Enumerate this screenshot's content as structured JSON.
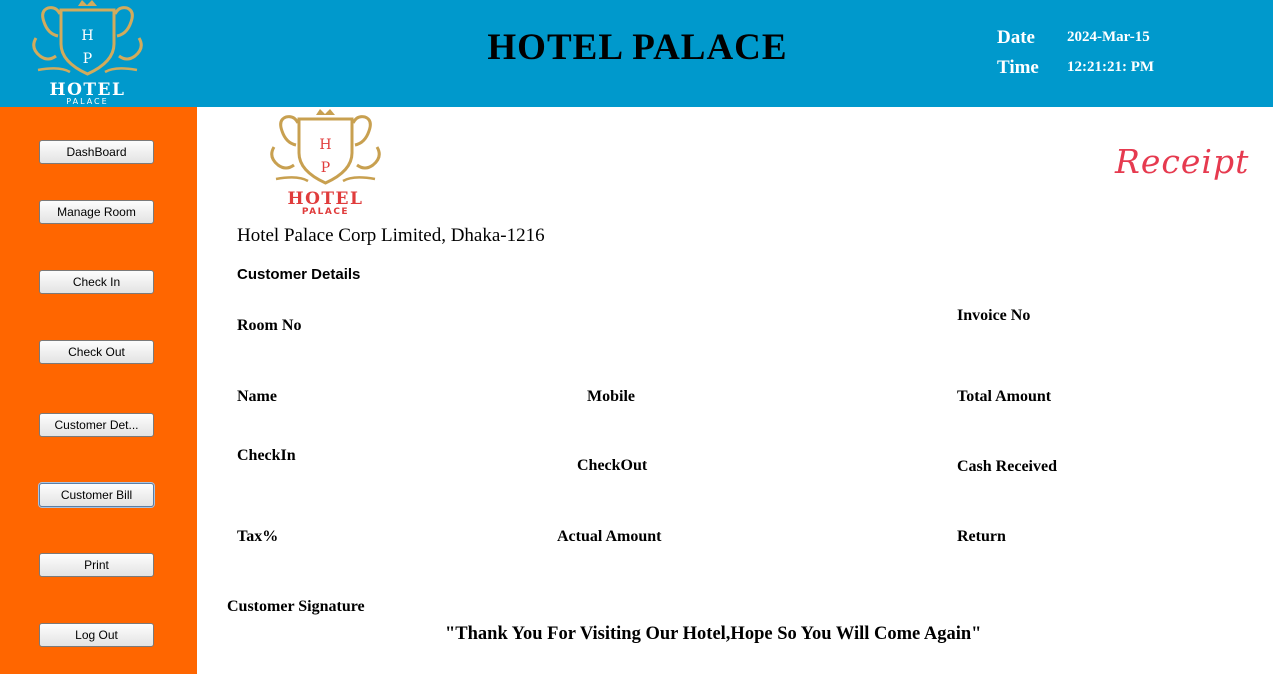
{
  "header": {
    "title": "HOTEL PALACE",
    "date_label": "Date",
    "date_value": "2024-Mar-15",
    "time_label": "Time",
    "time_value": "12:21:21: PM",
    "logo": {
      "monogram_top": "H",
      "monogram_bottom": "P",
      "name": "HOTEL",
      "sub": "PALACE"
    }
  },
  "sidebar": {
    "items": [
      {
        "label": "DashBoard"
      },
      {
        "label": "Manage Room"
      },
      {
        "label": "Check In"
      },
      {
        "label": "Check Out"
      },
      {
        "label": "Customer Det..."
      },
      {
        "label": "Customer Bill",
        "active": true
      },
      {
        "label": "Print"
      },
      {
        "label": "Log Out"
      }
    ]
  },
  "receipt": {
    "heading": "Receipt",
    "logo": {
      "monogram_top": "H",
      "monogram_bottom": "P",
      "name": "HOTEL",
      "sub": "PALACE"
    },
    "address": "Hotel Palace Corp Limited, Dhaka-1216",
    "section_title": "Customer Details",
    "fields": {
      "room_no": "Room No",
      "invoice_no": "Invoice No",
      "name": "Name",
      "mobile": "Mobile",
      "total_amount": "Total Amount",
      "checkin": "CheckIn",
      "checkout": "CheckOut",
      "cash_received": "Cash Received",
      "tax": "Tax%",
      "actual_amount": "Actual Amount",
      "return": "Return"
    },
    "signature_label": "Customer Signature",
    "thanks": "\"Thank You For Visiting Our Hotel,Hope So You Will Come Again\""
  },
  "colors": {
    "header_bg": "#0099cc",
    "sidebar_bg": "#ff6600",
    "logo_gold": "#c8a050",
    "logo_red": "#e03c3c",
    "receipt_pink": "#e63a4f"
  }
}
